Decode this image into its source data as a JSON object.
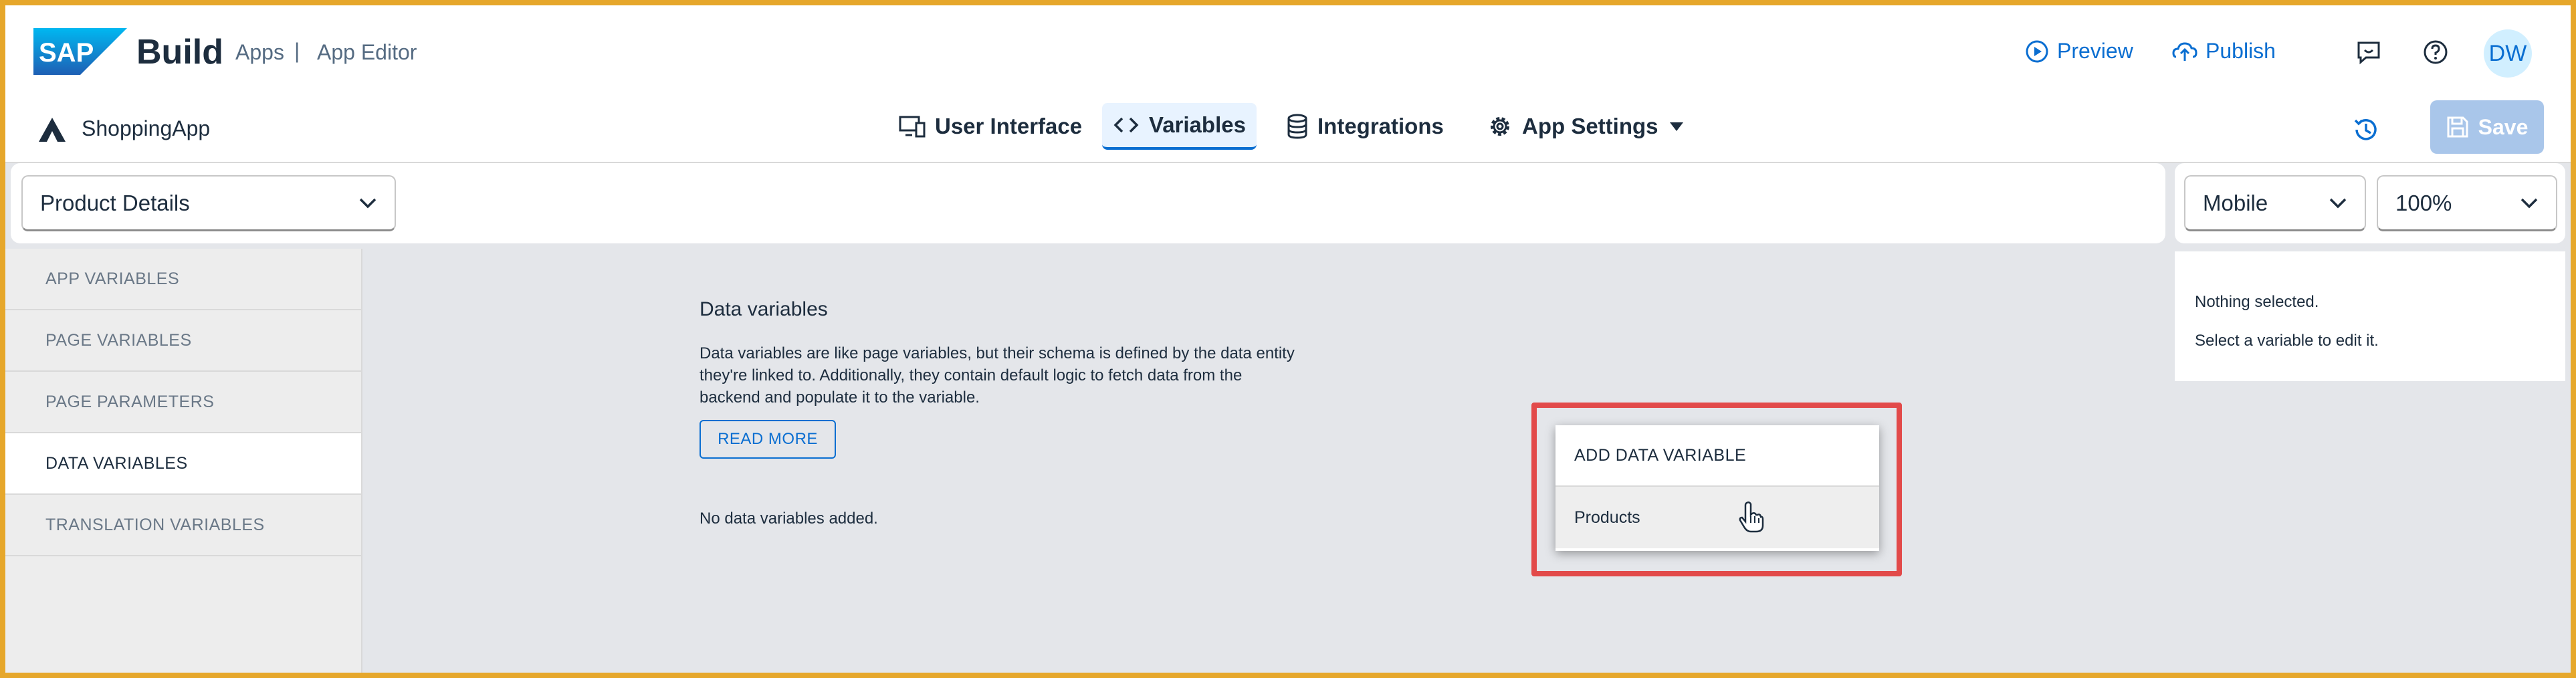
{
  "shellbar": {
    "brand": "SAP",
    "product": "Build",
    "apps": "Apps",
    "separator": "|",
    "app_editor": "App Editor",
    "preview": "Preview",
    "publish": "Publish",
    "avatar_initials": "DW"
  },
  "toolbar": {
    "app_name": "ShoppingApp",
    "tabs": [
      {
        "label": "User Interface",
        "icon": "monitor-mobile-icon"
      },
      {
        "label": "Variables",
        "icon": "code-icon",
        "active": true
      },
      {
        "label": "Integrations",
        "icon": "database-icon"
      },
      {
        "label": "App Settings",
        "icon": "gear-icon"
      }
    ],
    "save_label": "Save"
  },
  "page_select": {
    "value": "Product Details"
  },
  "device_select": {
    "value": "Mobile"
  },
  "zoom_select": {
    "value": "100%"
  },
  "leftnav": {
    "items": [
      {
        "label": "APP VARIABLES"
      },
      {
        "label": "PAGE VARIABLES"
      },
      {
        "label": "PAGE PARAMETERS"
      },
      {
        "label": "DATA VARIABLES",
        "active": true
      },
      {
        "label": "TRANSLATION VARIABLES"
      }
    ]
  },
  "main": {
    "title": "Data variables",
    "description": "Data variables are like page variables, but their schema is defined by the data entity they're linked to. Additionally, they contain default logic to fetch data from the backend and populate it to the variable.",
    "read_more": "READ MORE",
    "empty": "No data variables added."
  },
  "popup": {
    "header": "ADD DATA VARIABLE",
    "option": "Products"
  },
  "props": {
    "line1": "Nothing selected.",
    "line2": "Select a variable to edit it."
  },
  "colors": {
    "accent": "#0a6ed1",
    "highlight": "#e24a4a",
    "save_disabled": "#a9c6ea",
    "frame": "#e6a72b"
  }
}
